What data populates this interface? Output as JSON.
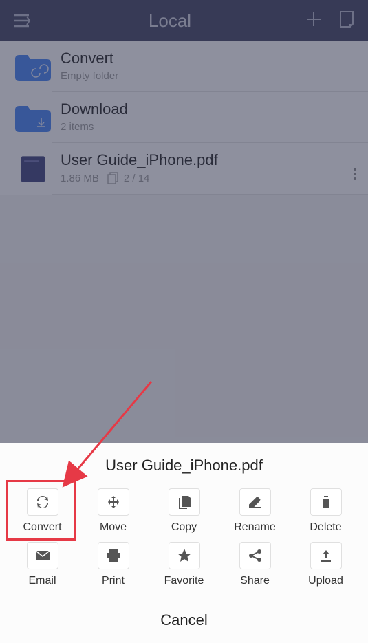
{
  "header": {
    "title": "Local"
  },
  "files": [
    {
      "name": "Convert",
      "meta": "Empty folder"
    },
    {
      "name": "Download",
      "meta": "2 items"
    },
    {
      "name": "User Guide_iPhone.pdf",
      "size": "1.86 MB",
      "pages": "2 / 14"
    }
  ],
  "sheet": {
    "title": "User Guide_iPhone.pdf",
    "actions": [
      {
        "label": "Convert"
      },
      {
        "label": "Move"
      },
      {
        "label": "Copy"
      },
      {
        "label": "Rename"
      },
      {
        "label": "Delete"
      },
      {
        "label": "Email"
      },
      {
        "label": "Print"
      },
      {
        "label": "Favorite"
      },
      {
        "label": "Share"
      },
      {
        "label": "Upload"
      }
    ],
    "cancel": "Cancel"
  }
}
